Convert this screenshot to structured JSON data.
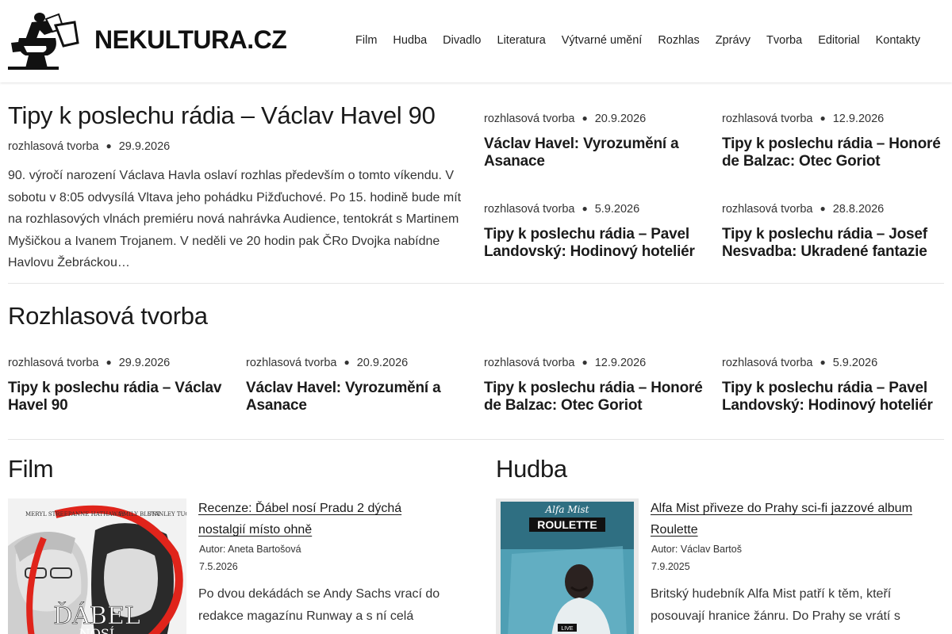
{
  "site": {
    "title": "NEKULTURA.CZ",
    "logo_icon": "toilet-reader-logo"
  },
  "nav": [
    {
      "label": "Film"
    },
    {
      "label": "Hudba"
    },
    {
      "label": "Divadlo"
    },
    {
      "label": "Literatura"
    },
    {
      "label": "Výtvarné umění"
    },
    {
      "label": "Rozhlas"
    },
    {
      "label": "Zprávy"
    },
    {
      "label": "Tvorba"
    },
    {
      "label": "Editorial"
    },
    {
      "label": "Kontakty"
    }
  ],
  "featured": {
    "title": "Tipy k poslechu rádia – Václav Havel 90",
    "category": "rozhlasová tvorba",
    "date": "29.9.2026",
    "excerpt": "90. výročí narození Václava Havla oslaví rozhlas především o tomto víkendu. V sobotu v 8:05 odvysílá Vltava jeho pohádku Pižďuchové. Po 15. hodině bude mít na rozhlasových vlnách premiéru nová nahrávka Audience, tentokrát s Martinem Myšičkou a Ivanem Trojanem. V neděli ve 20 hodin pak ČRo Dvojka nabídne Havlovu Žebráckou…"
  },
  "side_posts": [
    {
      "category": "rozhlasová tvorba",
      "date": "20.9.2026",
      "title": "Václav Havel: Vyrozumění a Asanace"
    },
    {
      "category": "rozhlasová tvorba",
      "date": "12.9.2026",
      "title": "Tipy k poslechu rádia – Honoré de Balzac: Otec Goriot"
    },
    {
      "category": "rozhlasová tvorba",
      "date": "5.9.2026",
      "title": "Tipy k poslechu rádia – Pavel Landovský: Hodinový hoteliér"
    },
    {
      "category": "rozhlasová tvorba",
      "date": "28.8.2026",
      "title": "Tipy k poslechu rádia – Josef Nesvadba: Ukradené fantazie"
    }
  ],
  "rozhlas": {
    "heading": "Rozhlasová tvorba",
    "posts": [
      {
        "category": "rozhlasová tvorba",
        "date": "29.9.2026",
        "title": "Tipy k poslechu rádia – Václav Havel 90"
      },
      {
        "category": "rozhlasová tvorba",
        "date": "20.9.2026",
        "title": "Václav Havel: Vyrozumění a Asanace"
      },
      {
        "category": "rozhlasová tvorba",
        "date": "12.9.2026",
        "title": "Tipy k poslechu rádia – Honoré de Balzac: Otec Goriot"
      },
      {
        "category": "rozhlasová tvorba",
        "date": "5.9.2026",
        "title": "Tipy k poslechu rádia – Pavel Landovský: Hodinový hoteliér"
      }
    ]
  },
  "film": {
    "heading": "Film",
    "post": {
      "title": "Recenze: Ďábel nosí Pradu 2 dýchá nostalgií místo ohně",
      "author": "Autor: Aneta Bartošová",
      "date": "7.5.2026",
      "excerpt": "Po dvou dekádách se Andy Sachs vrací do redakce magazínu Runway a s ní celá",
      "poster": {
        "actors": [
          "MERYL STREEP",
          "ANNE HATHAWAY",
          "EMILY BLUNT",
          "STANLEY TUCCI"
        ],
        "title_line1": "ĎÁBEL",
        "title_line2": "NOSÍ",
        "accent": "#e0241b"
      }
    }
  },
  "hudba": {
    "heading": "Hudba",
    "post": {
      "title": "Alfa Mist přiveze do Prahy sci-fi jazzové album Roulette",
      "author": "Autor: Václav Bartoš",
      "date": "7.9.2025",
      "excerpt": "Britský hudebník Alfa Mist patří k těm, kteří posouvají hranice žánru. Do Prahy se vrátí s",
      "cover": {
        "artist": "Alfa Mist",
        "album": "ROULETTE",
        "badge": "LIVE",
        "tint": "#4f9fb4"
      }
    }
  }
}
